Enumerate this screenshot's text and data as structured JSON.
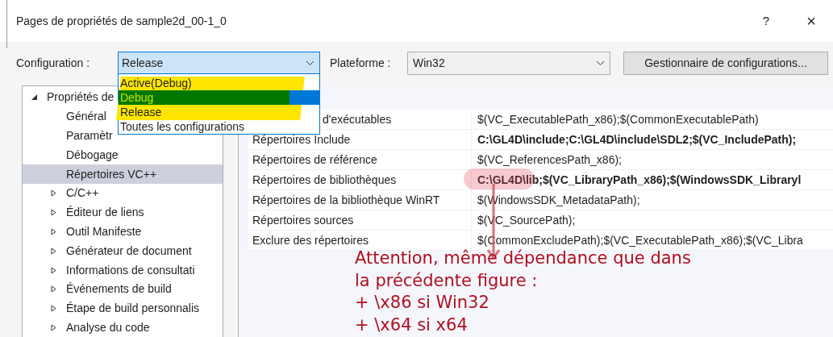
{
  "window": {
    "title": "Pages de propriétés de sample2d_00-1_0",
    "help": "?",
    "close": "×"
  },
  "toolbar": {
    "configuration_label": "Configuration :",
    "configuration_value": "Release",
    "platform_label": "Plateforme :",
    "platform_value": "Win32",
    "manager_button": "Gestionnaire de configurations..."
  },
  "configuration_dropdown": {
    "items": [
      {
        "label": "Active(Debug)",
        "selected": false
      },
      {
        "label": "Debug",
        "selected": true
      },
      {
        "label": "Release",
        "selected": false
      },
      {
        "label": "Toutes les configurations",
        "selected": false
      }
    ]
  },
  "tree": [
    {
      "label": "Propriétés de",
      "expanded": true,
      "selected": false,
      "children": [
        {
          "label": "Général",
          "selected": false,
          "expandable": false
        },
        {
          "label": "Paramètr",
          "selected": false,
          "expandable": false
        },
        {
          "label": "Débogage",
          "selected": false,
          "expandable": false
        },
        {
          "label": "Répertoires VC++",
          "selected": true,
          "expandable": false
        },
        {
          "label": "C/C++",
          "selected": false,
          "expandable": true
        },
        {
          "label": "Éditeur de liens",
          "selected": false,
          "expandable": true
        },
        {
          "label": "Outil Manifeste",
          "selected": false,
          "expandable": true
        },
        {
          "label": "Générateur de document",
          "selected": false,
          "expandable": true
        },
        {
          "label": "Informations de consultati",
          "selected": false,
          "expandable": true
        },
        {
          "label": "Événements de build",
          "selected": false,
          "expandable": true
        },
        {
          "label": "Étape de build personnalis",
          "selected": false,
          "expandable": true
        },
        {
          "label": "Analyse du code",
          "selected": false,
          "expandable": true
        }
      ]
    }
  ],
  "properties": [
    {
      "name": "d'exécutables",
      "value": "$(VC_ExecutablePath_x86);$(CommonExecutablePath)",
      "modified": false
    },
    {
      "name": "Répertoires Include",
      "value": "C:\\GL4D\\include;C:\\GL4D\\include\\SDL2;$(VC_IncludePath);",
      "modified": true
    },
    {
      "name": "Répertoires de référence",
      "value": "$(VC_ReferencesPath_x86);",
      "modified": false
    },
    {
      "name": "Répertoires de bibliothèques",
      "value": "C:\\GL4D\\lib;$(VC_LibraryPath_x86);$(WindowsSDK_Libraryl",
      "modified": true
    },
    {
      "name": "Répertoires de la bibliothèque WinRT",
      "value": "$(WindowsSDK_MetadataPath);",
      "modified": false
    },
    {
      "name": "Répertoires sources",
      "value": "$(VC_SourcePath);",
      "modified": false
    },
    {
      "name": "Exclure des répertoires",
      "value": "$(CommonExcludePath);$(VC_ExecutablePath_x86);$(VC_Libra",
      "modified": false
    }
  ],
  "annotation": {
    "lines": [
      "Attention, même dépendance que dans",
      "la précédente figure :",
      "+ \\x86 si Win32",
      "+ \\x64 si x64"
    ]
  }
}
